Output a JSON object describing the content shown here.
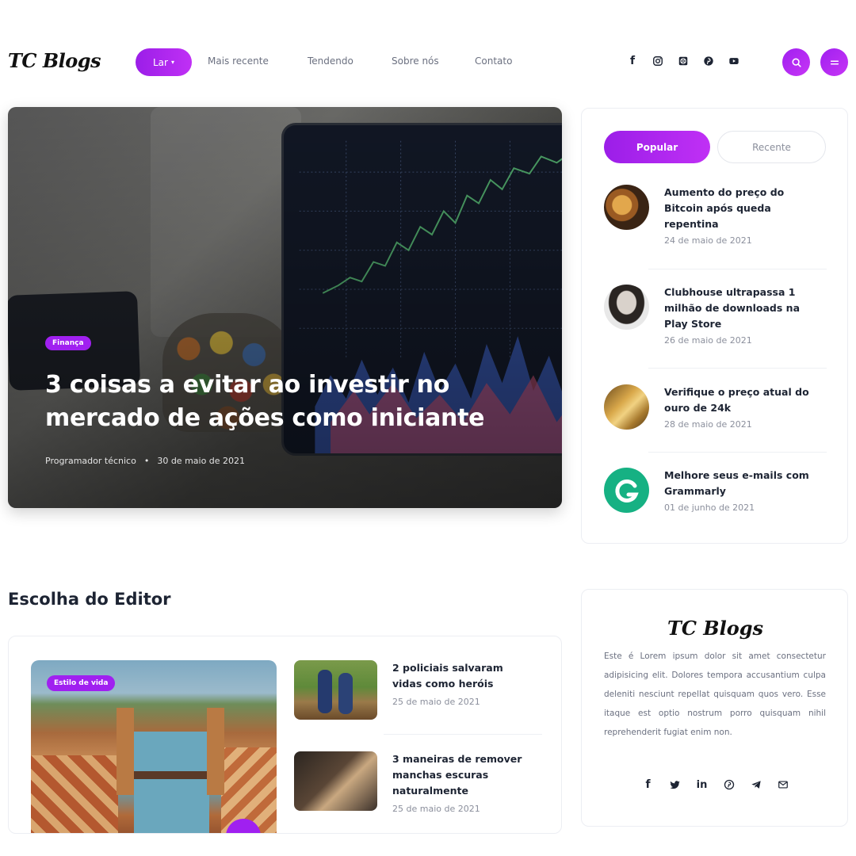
{
  "header": {
    "logo": "TC Blogs",
    "nav": {
      "home": "Lar",
      "links": [
        "Mais recente",
        "Tendendo",
        "Sobre nós",
        "Contato"
      ]
    },
    "socials": [
      "facebook-icon",
      "instagram-icon",
      "dribbble-icon",
      "pinterest-icon",
      "youtube-icon"
    ]
  },
  "hero": {
    "category": "Finança",
    "title": "3 coisas a evitar ao investir no mercado de ações como iniciante",
    "author": "Programador técnico",
    "separator": "•",
    "date": "30 de maio de 2021"
  },
  "sidebar": {
    "tabs": {
      "popular": "Popular",
      "recent": "Recente"
    },
    "posts": [
      {
        "title": "Aumento do preço do Bitcoin após queda repentina",
        "date": "24 de maio de 2021"
      },
      {
        "title": "Clubhouse ultrapassa 1 milhão de downloads na Play Store",
        "date": "26 de maio de 2021"
      },
      {
        "title": "Verifique o preço atual do ouro de 24k",
        "date": "28 de maio de 2021"
      },
      {
        "title": "Melhore seus e-mails com Grammarly",
        "date": "01 de junho de 2021"
      }
    ]
  },
  "editor": {
    "section_title": "Escolha do Editor",
    "main_category": "Estilo de vida",
    "posts": [
      {
        "title": "2 policiais salvaram vidas como heróis",
        "date": "25 de maio de 2021"
      },
      {
        "title": "3 maneiras de remover manchas escuras naturalmente",
        "date": "25 de maio de 2021"
      }
    ]
  },
  "about": {
    "logo": "TC Blogs",
    "text": "Este é Lorem ipsum dolor sit amet consectetur adipisicing elit. Dolores tempora accusantium culpa deleniti nesciunt repellat quisquam quos vero. Esse itaque est optio nostrum porro quisquam nihil reprehenderit fugiat enim non.",
    "socials": [
      "facebook-icon",
      "twitter-icon",
      "linkedin-icon",
      "pinterest-icon",
      "telegram-icon",
      "mail-icon"
    ],
    "linkedin_glyph": "in"
  },
  "colors": {
    "accent": "#a020f0",
    "text": "#1d2433",
    "muted": "#8b8f9c"
  }
}
